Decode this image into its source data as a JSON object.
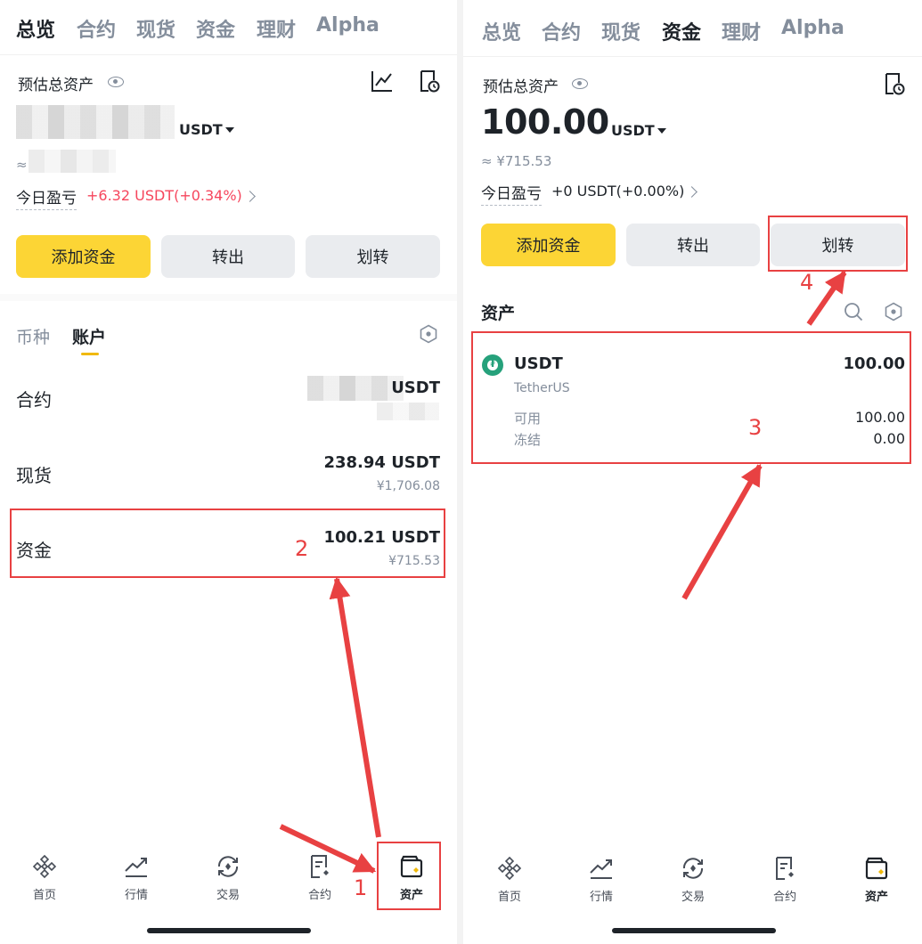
{
  "left": {
    "tabs": [
      "总览",
      "合约",
      "现货",
      "资金",
      "理财",
      "Alpha"
    ],
    "active_tab": "总览",
    "est_label": "预估总资产",
    "unit": "USDT",
    "approx_prefix": "≈",
    "pnl_label": "今日盈亏",
    "pnl_value": "+6.32 USDT(+0.34%)",
    "buttons": {
      "add": "添加资金",
      "withdraw": "转出",
      "transfer": "划转"
    },
    "sub_tabs": [
      "币种",
      "账户"
    ],
    "rows": [
      {
        "label": "合约",
        "amount_suffix": "USDT",
        "cny": ""
      },
      {
        "label": "现货",
        "amount": "238.94 USDT",
        "cny": "¥1,706.08"
      },
      {
        "label": "资金",
        "amount": "100.21 USDT",
        "cny": "¥715.53"
      }
    ]
  },
  "right": {
    "tabs": [
      "总览",
      "合约",
      "现货",
      "资金",
      "理财",
      "Alpha"
    ],
    "active_tab": "资金",
    "est_label": "预估总资产",
    "amount": "100.00",
    "unit": "USDT",
    "approx": "≈ ¥715.53",
    "pnl_label": "今日盈亏",
    "pnl_value": "+0 USDT(+0.00%)",
    "buttons": {
      "add": "添加资金",
      "withdraw": "转出",
      "transfer": "划转"
    },
    "assets_title": "资产",
    "coin": {
      "symbol": "USDT",
      "name": "TetherUS",
      "total": "100.00",
      "available_label": "可用",
      "available": "100.00",
      "frozen_label": "冻结",
      "frozen": "0.00"
    }
  },
  "nav": [
    "首页",
    "行情",
    "交易",
    "合约",
    "资产"
  ],
  "annotations": [
    "1",
    "2",
    "3",
    "4"
  ],
  "colors": {
    "accent": "#fcd535",
    "profit": "#f6465d",
    "highlight": "#e84142",
    "usdt": "#26a17b"
  }
}
